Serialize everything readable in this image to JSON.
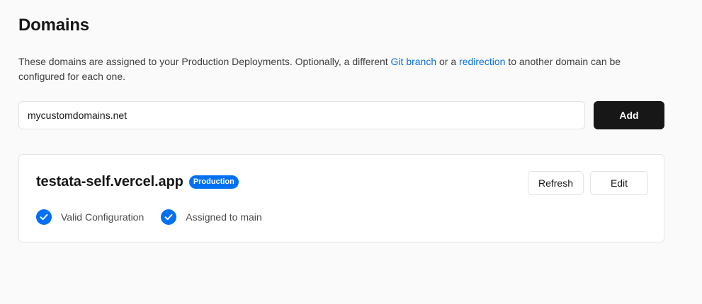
{
  "header": {
    "title": "Domains"
  },
  "description": {
    "part1": "These domains are assigned to your Production Deployments. Optionally, a different ",
    "link1": "Git branch",
    "part2": " or a ",
    "link2": "redirection",
    "part3": " to another domain can be configured for each one."
  },
  "add_domain": {
    "input_value": "mycustomdomains.net",
    "button_label": "Add"
  },
  "domain_card": {
    "name": "testata-self.vercel.app",
    "badge": "Production",
    "refresh_label": "Refresh",
    "edit_label": "Edit",
    "statuses": [
      {
        "label": "Valid Configuration",
        "icon": "check-circle-icon"
      },
      {
        "label": "Assigned to main",
        "icon": "check-circle-icon"
      }
    ]
  },
  "colors": {
    "accent": "#0070f3",
    "link": "#0b6fd8",
    "primary_button": "#171717",
    "background": "#fafafa"
  }
}
